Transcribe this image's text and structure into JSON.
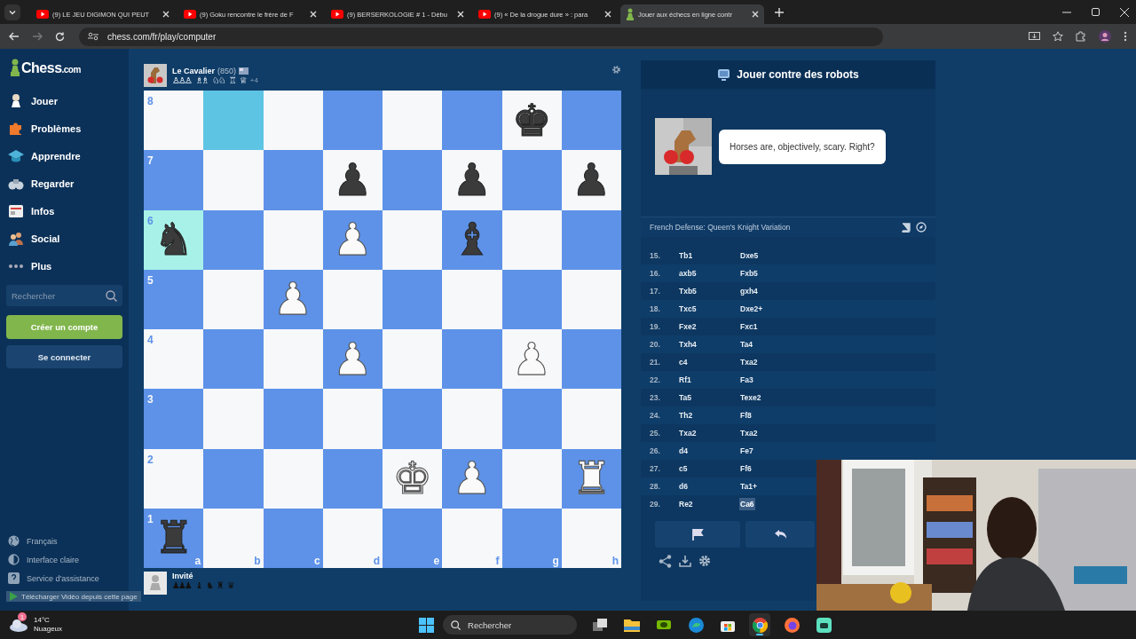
{
  "browser": {
    "tabs": [
      {
        "title": "(9) LE JEU DIGIMON QUI PEUT",
        "kind": "video",
        "selected": false
      },
      {
        "title": "(9) Goku rencontre le frère de F",
        "kind": "video",
        "selected": false
      },
      {
        "title": "(9) BERSERKOLOGIE # 1 - Débu",
        "kind": "video",
        "selected": false
      },
      {
        "title": "(9) « De la drogue dure » : para",
        "kind": "video",
        "selected": false
      },
      {
        "title": "Jouer aux échecs en ligne contr",
        "kind": "chess",
        "selected": true
      }
    ],
    "url": "chess.com/fr/play/computer"
  },
  "sidebar": {
    "logo": "Chess",
    "logo_suffix": ".com",
    "items": [
      {
        "label": "Jouer",
        "kind": "play"
      },
      {
        "label": "Problèmes",
        "kind": "puzzle"
      },
      {
        "label": "Apprendre",
        "kind": "learn"
      },
      {
        "label": "Regarder",
        "kind": "watch"
      },
      {
        "label": "Infos",
        "kind": "news"
      },
      {
        "label": "Social",
        "kind": "social"
      },
      {
        "label": "Plus",
        "kind": "more"
      }
    ],
    "search": {
      "placeholder": "Rechercher"
    },
    "signup": "Créer un compte",
    "login": "Se connecter",
    "footer": [
      {
        "label": "Français",
        "kind": "globe"
      },
      {
        "label": "Interface claire",
        "kind": "contrast"
      },
      {
        "label": "Service d'assistance",
        "kind": "help"
      }
    ]
  },
  "top_player": {
    "name": "Le Cavalier",
    "rating": "(850)",
    "captured": [
      "♙♙♙",
      "♗♗",
      "♘♘",
      "♖",
      "♕"
    ],
    "advantage": "+4"
  },
  "board": {
    "files": [
      "a",
      "b",
      "c",
      "d",
      "e",
      "f",
      "g",
      "h"
    ],
    "ranks": [
      {
        "label": "8",
        "squares": [
          {
            "highlighted": false
          },
          {
            "highlighted": true
          },
          {
            "highlighted": false
          },
          {
            "highlighted": false
          },
          {
            "highlighted": false
          },
          {
            "highlighted": false
          },
          {
            "piece": "♚",
            "white": false,
            "highlighted": false
          },
          {
            "highlighted": false
          }
        ]
      },
      {
        "label": "7",
        "squares": [
          {
            "highlighted": false
          },
          {
            "highlighted": false
          },
          {
            "highlighted": false
          },
          {
            "piece": "♟",
            "white": false,
            "highlighted": false
          },
          {
            "highlighted": false
          },
          {
            "piece": "♟",
            "white": false,
            "highlighted": false
          },
          {
            "highlighted": false
          },
          {
            "piece": "♟",
            "white": false,
            "highlighted": false
          }
        ]
      },
      {
        "label": "6",
        "squares": [
          {
            "piece": "♞",
            "white": false,
            "highlighted": true
          },
          {
            "highlighted": false
          },
          {
            "highlighted": false
          },
          {
            "piece": "♟",
            "white": true,
            "highlighted": false
          },
          {
            "highlighted": false
          },
          {
            "piece": "♝",
            "white": false,
            "highlighted": false
          },
          {
            "highlighted": false
          },
          {
            "highlighted": false
          }
        ]
      },
      {
        "label": "5",
        "squares": [
          {
            "highlighted": false
          },
          {
            "highlighted": false
          },
          {
            "piece": "♟",
            "white": true,
            "highlighted": false
          },
          {
            "highlighted": false
          },
          {
            "highlighted": false
          },
          {
            "highlighted": false
          },
          {
            "highlighted": false
          },
          {
            "highlighted": false
          }
        ]
      },
      {
        "label": "4",
        "squares": [
          {
            "highlighted": false
          },
          {
            "highlighted": false
          },
          {
            "highlighted": false
          },
          {
            "piece": "♟",
            "white": true,
            "highlighted": false
          },
          {
            "highlighted": false
          },
          {
            "highlighted": false
          },
          {
            "piece": "♟",
            "white": true,
            "highlighted": false
          },
          {
            "highlighted": false
          }
        ]
      },
      {
        "label": "3",
        "squares": [
          {
            "highlighted": false
          },
          {
            "highlighted": false
          },
          {
            "highlighted": false
          },
          {
            "highlighted": false
          },
          {
            "highlighted": false
          },
          {
            "highlighted": false
          },
          {
            "highlighted": false
          },
          {
            "highlighted": false
          }
        ]
      },
      {
        "label": "2",
        "squares": [
          {
            "highlighted": false
          },
          {
            "highlighted": false
          },
          {
            "highlighted": false
          },
          {
            "highlighted": false
          },
          {
            "piece": "♚",
            "white": true,
            "highlighted": false
          },
          {
            "piece": "♟",
            "white": true,
            "highlighted": false
          },
          {
            "highlighted": false
          },
          {
            "piece": "♜",
            "white": true,
            "highlighted": false
          }
        ]
      },
      {
        "label": "1",
        "squares": [
          {
            "piece": "♜",
            "white": false,
            "highlighted": false
          },
          {
            "highlighted": false
          },
          {
            "highlighted": false
          },
          {
            "highlighted": false
          },
          {
            "highlighted": false
          },
          {
            "highlighted": false
          },
          {
            "highlighted": false
          },
          {
            "highlighted": false
          }
        ]
      }
    ]
  },
  "bottom_player": {
    "name": "Invité",
    "captured": [
      "♟♟♟",
      "♝",
      "♞",
      "♜",
      "♛"
    ]
  },
  "overlay": {
    "text": "Télécharger Vidéo depuis cette page"
  },
  "panel": {
    "title": "Jouer contre des robots",
    "message": "Horses are, objectively, scary. Right?",
    "opening": "French Defense: Queen's Knight Variation",
    "moves": [
      {
        "number": "15.",
        "white": {
          "san": "Tb1",
          "selected": false
        },
        "black": {
          "san": "Dxe5",
          "selected": false
        }
      },
      {
        "number": "16.",
        "white": {
          "san": "axb5",
          "selected": false
        },
        "black": {
          "san": "Fxb5",
          "selected": false
        }
      },
      {
        "number": "17.",
        "white": {
          "san": "Txb5",
          "selected": false
        },
        "black": {
          "san": "gxh4",
          "selected": false
        }
      },
      {
        "number": "18.",
        "white": {
          "san": "Txc5",
          "selected": false
        },
        "black": {
          "san": "Dxe2+",
          "selected": false
        }
      },
      {
        "number": "19.",
        "white": {
          "san": "Fxe2",
          "selected": false
        },
        "black": {
          "san": "Fxc1",
          "selected": false
        }
      },
      {
        "number": "20.",
        "white": {
          "san": "Txh4",
          "selected": false
        },
        "black": {
          "san": "Ta4",
          "selected": false
        }
      },
      {
        "number": "21.",
        "white": {
          "san": "c4",
          "selected": false
        },
        "black": {
          "san": "Txa2",
          "selected": false
        }
      },
      {
        "number": "22.",
        "white": {
          "san": "Rf1",
          "selected": false
        },
        "black": {
          "san": "Fa3",
          "selected": false
        }
      },
      {
        "number": "23.",
        "white": {
          "san": "Ta5",
          "selected": false
        },
        "black": {
          "san": "Texe2",
          "selected": false
        }
      },
      {
        "number": "24.",
        "white": {
          "san": "Th2",
          "selected": false
        },
        "black": {
          "san": "Ff8",
          "selected": false
        }
      },
      {
        "number": "25.",
        "white": {
          "san": "Txa2",
          "selected": false
        },
        "black": {
          "san": "Txa2",
          "selected": false
        }
      },
      {
        "number": "26.",
        "white": {
          "san": "d4",
          "selected": false
        },
        "black": {
          "san": "Fe7",
          "selected": false
        }
      },
      {
        "number": "27.",
        "white": {
          "san": "c5",
          "selected": false
        },
        "black": {
          "san": "Ff6",
          "selected": false
        }
      },
      {
        "number": "28.",
        "white": {
          "san": "d6",
          "selected": false
        },
        "black": {
          "san": "Ta1+",
          "selected": false
        }
      },
      {
        "number": "29.",
        "white": {
          "san": "Re2",
          "selected": false
        },
        "black": {
          "san": "Ca6",
          "selected": true
        }
      }
    ]
  },
  "taskbar": {
    "weather": {
      "temperature": "14°C",
      "condition": "Nuageux",
      "badge": "1"
    },
    "search": {
      "placeholder": "Rechercher"
    },
    "apps": [
      {
        "kind": "taskview",
        "active": false
      },
      {
        "kind": "folder",
        "active": false
      },
      {
        "kind": "nvidia",
        "active": false
      },
      {
        "kind": "edge",
        "active": false
      },
      {
        "kind": "store",
        "active": false
      },
      {
        "kind": "chrome",
        "active": true
      },
      {
        "kind": "firefox",
        "active": false
      },
      {
        "kind": "chat",
        "active": false
      }
    ]
  }
}
